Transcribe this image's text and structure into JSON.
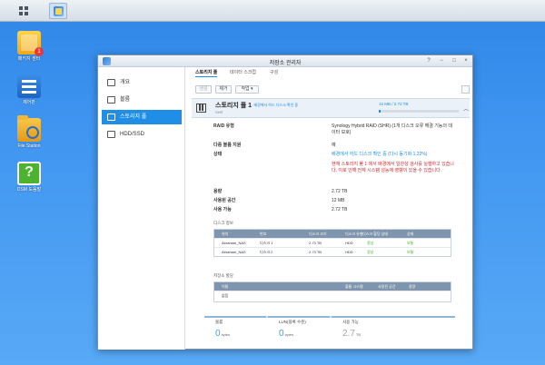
{
  "desktop": {
    "icons": [
      {
        "label": "패키지 센터",
        "badge": "1",
        "icon": "package-center-icon"
      },
      {
        "label": "제어판",
        "icon": "control-panel-icon"
      },
      {
        "label": "File Station",
        "icon": "file-station-icon"
      },
      {
        "label": "DSM 도움말",
        "icon": "help-icon"
      }
    ]
  },
  "window": {
    "title": "저장소 관리자",
    "controls": [
      "?",
      "−",
      "□",
      "×"
    ]
  },
  "sidebar": {
    "items": [
      {
        "label": "개요",
        "icon": "overview-icon"
      },
      {
        "label": "볼륨",
        "icon": "volume-icon"
      },
      {
        "label": "스토리지 풀",
        "icon": "storage-pool-icon",
        "active": true
      },
      {
        "label": "HDD/SSD",
        "icon": "hdd-icon"
      }
    ]
  },
  "tabs": [
    "스토리지 풀",
    "데이터 스크럽",
    "구성"
  ],
  "toolbar": {
    "create": "생성",
    "remove": "제거",
    "action": "작업 ▾"
  },
  "pool": {
    "name": "스토리지 풀 1",
    "status_inline": "- 배경에서 하드 디스크 확인 중",
    "type": "SHR",
    "capacity": "12 MB / 2.72 TB",
    "used_fraction": 0.02
  },
  "properties": [
    {
      "key": "RAID 유형",
      "value": "Synology Hybrid RAID (SHR) (1개 디스크 오류 해결 기능의 데이터 보호)",
      "tone": "normal"
    },
    {
      "key": "다중 볼륨 지원",
      "value": "예",
      "tone": "normal"
    },
    {
      "key": "상태",
      "value": "배경에서 하드 디스크 확인 중 (다시 동기화 1.22%)",
      "tone": "blue"
    },
    {
      "key": "",
      "value": "현재 스토리지 풀 1 에서 배경에서 일관성 검사를 실행하고 있습니다. 이로 인해 전체 시스템 성능에 영향이 있을 수 있습니다.",
      "tone": "red"
    },
    {
      "key": "용량",
      "value": "2.72 TB",
      "tone": "normal"
    },
    {
      "key": "사용된 공간",
      "value": "12 MB",
      "tone": "normal"
    },
    {
      "key": "사용 가능",
      "value": "2.72 TB",
      "tone": "normal"
    }
  ],
  "disk_info": {
    "title": "디스크 정보",
    "columns": [
      "위치",
      "번호",
      "디스크 크기",
      "디스크 유형",
      "디스크 할당 상태",
      "상태"
    ],
    "rows": [
      [
        "Abraham_NAS",
        "디스크 1",
        "2.73 TB",
        "HDD",
        "정상",
        "보통"
      ],
      [
        "Abraham_NAS",
        "디스크 2",
        "2.73 TB",
        "HDD",
        "정상",
        "보통"
      ]
    ]
  },
  "allocation": {
    "title": "저장소 할당",
    "columns": [
      "이름",
      "",
      "볼륨 시스템",
      "사용된 공간",
      "용량"
    ],
    "rows": [
      [
        "없음"
      ]
    ]
  },
  "summary": [
    {
      "label": "볼륨",
      "value": "0",
      "unit": "bytes"
    },
    {
      "label": "LUN(블록 수준)",
      "value": "0",
      "unit": "bytes"
    },
    {
      "label": "사용 가능",
      "value": "2.7",
      "unit": "TB"
    }
  ]
}
